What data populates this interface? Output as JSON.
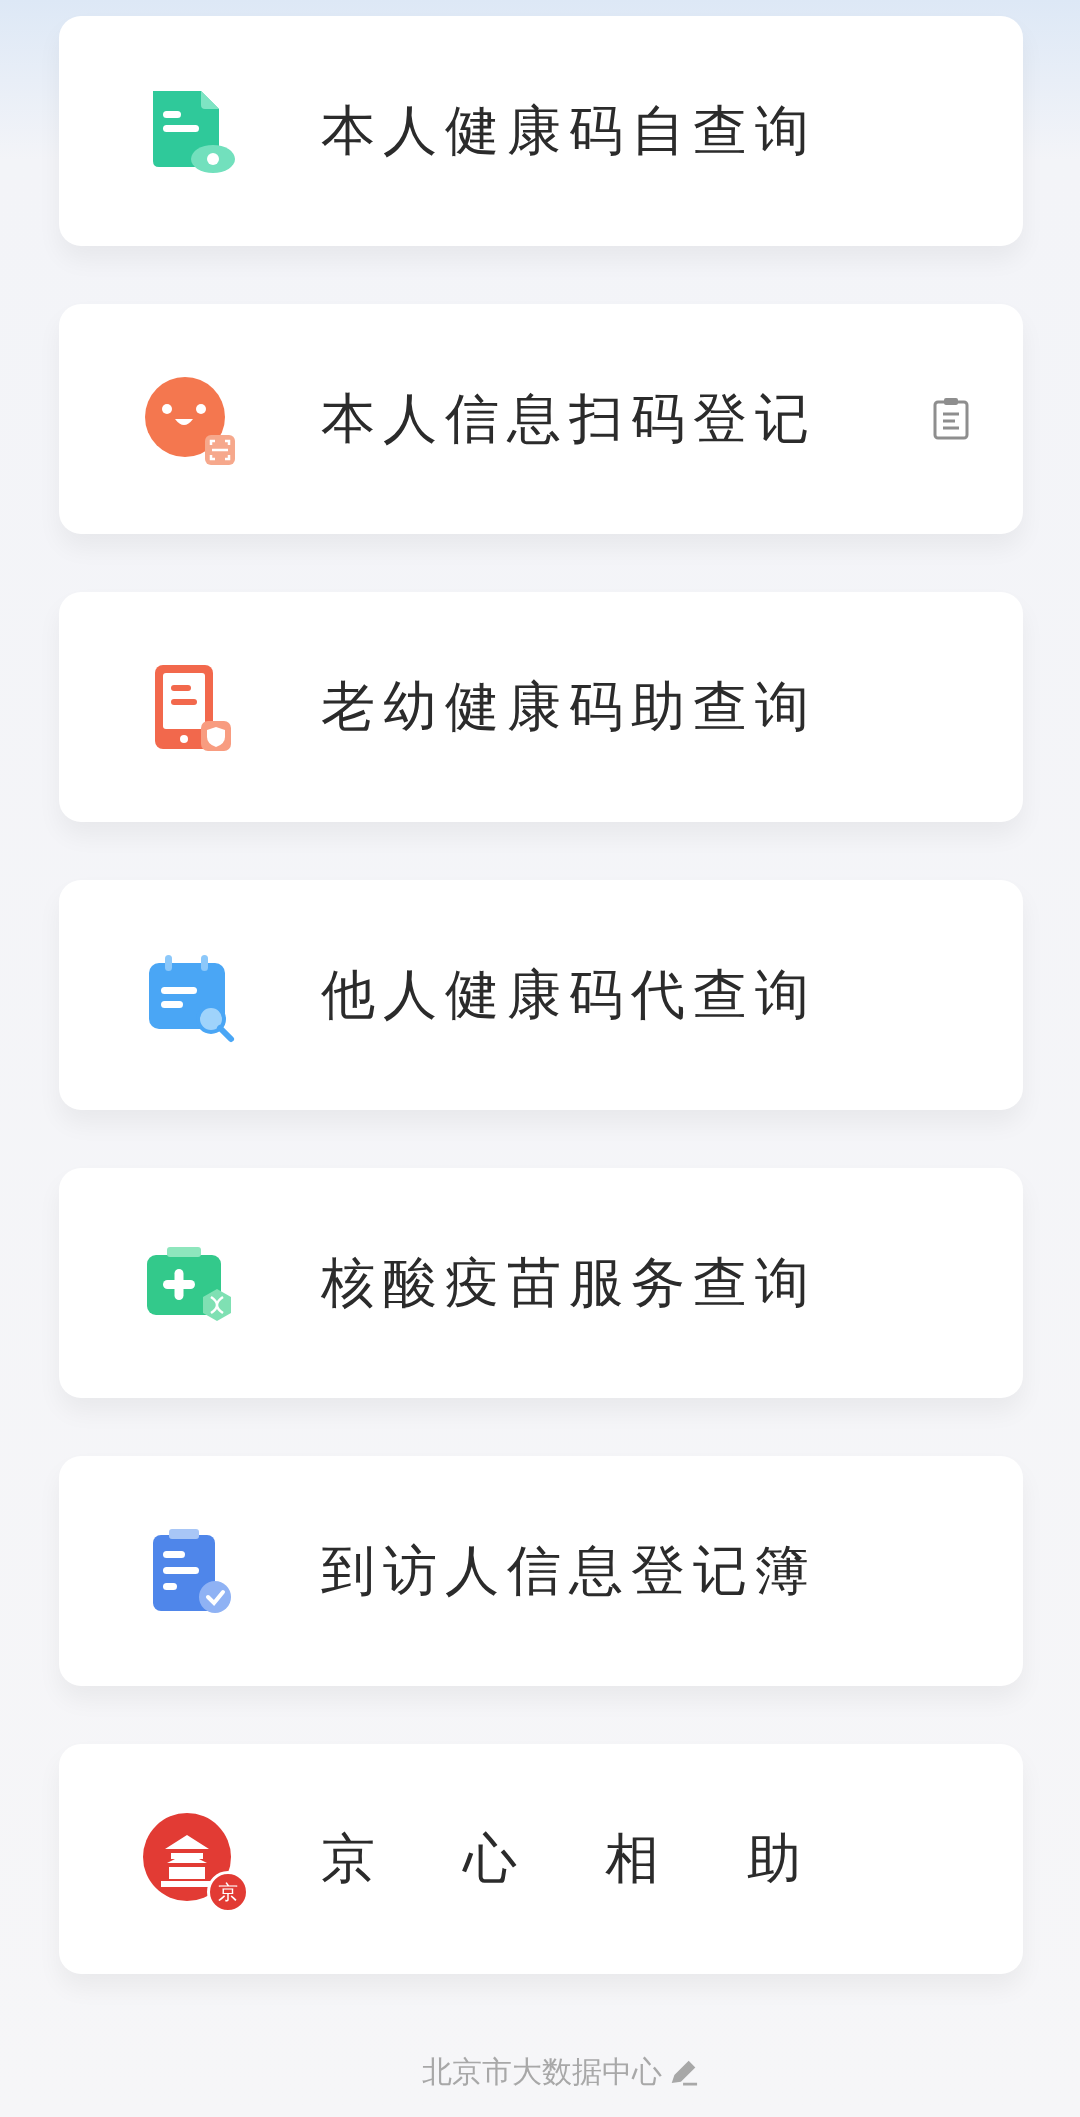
{
  "services": [
    {
      "label": "本人健康码自查询",
      "kind": "plain",
      "note_button": false
    },
    {
      "label": "本人信息扫码登记",
      "kind": "plain",
      "note_button": true
    },
    {
      "label": "老幼健康码助查询",
      "kind": "plain",
      "note_button": false
    },
    {
      "label": "他人健康码代查询",
      "kind": "plain",
      "note_button": false
    },
    {
      "label": "核酸疫苗服务查询",
      "kind": "plain",
      "note_button": false
    },
    {
      "label": "到访人信息登记簿",
      "kind": "plain",
      "note_button": false
    },
    {
      "label": "京心相助",
      "kind": "spaced",
      "note_button": false,
      "badge": "京"
    }
  ],
  "footer": {
    "text": "北京市大数据中心"
  }
}
